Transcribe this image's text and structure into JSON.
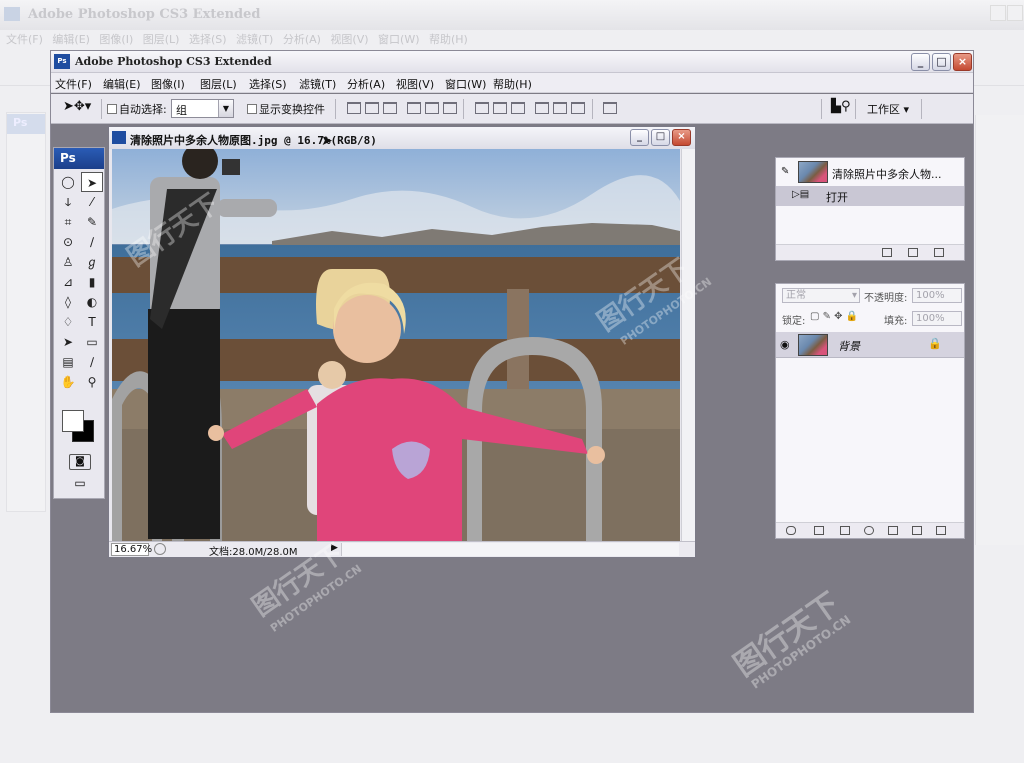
{
  "ghost": {
    "title": "Adobe Photoshop CS3 Extended",
    "menu": "文件(F)  编辑(E)  图像(I)  图层(L)  选择(S)  滤镜(T)  分析(A)  视图(V)  窗口(W)  帮助(H)",
    "ps_label": "Ps"
  },
  "app": {
    "title": "Adobe Photoshop CS3 Extended",
    "logo": "Ps",
    "minimize": "_",
    "maximize": "□",
    "close": "×"
  },
  "menubar": [
    "文件(F)",
    "编辑(E)",
    "图像(I)",
    "图层(L)",
    "选择(S)",
    "滤镜(T)",
    "分析(A)",
    "视图(V)",
    "窗口(W)",
    "帮助(H)"
  ],
  "options": {
    "auto_select_label": "自动选择:",
    "auto_select_value": "组",
    "show_transform_label": "显示变换控件",
    "workspace_label": "工作区 ▾"
  },
  "toolbox": {
    "header": "Ps",
    "tools": [
      {
        "name": "marquee-icon",
        "glyph": "◯"
      },
      {
        "name": "move-icon",
        "glyph": "➤"
      },
      {
        "name": "lasso-icon",
        "glyph": "ↆ"
      },
      {
        "name": "magic-wand-icon",
        "glyph": "⁄"
      },
      {
        "name": "crop-icon",
        "glyph": "⌗"
      },
      {
        "name": "slice-icon",
        "glyph": "✎"
      },
      {
        "name": "healing-icon",
        "glyph": "⊙"
      },
      {
        "name": "brush-icon",
        "glyph": "∕"
      },
      {
        "name": "stamp-icon",
        "glyph": "♙"
      },
      {
        "name": "history-brush-icon",
        "glyph": "ℊ"
      },
      {
        "name": "eraser-icon",
        "glyph": "⊿"
      },
      {
        "name": "gradient-icon",
        "glyph": "▮"
      },
      {
        "name": "blur-icon",
        "glyph": "◊"
      },
      {
        "name": "dodge-icon",
        "glyph": "◐"
      },
      {
        "name": "pen-icon",
        "glyph": "♢"
      },
      {
        "name": "type-icon",
        "glyph": "T"
      },
      {
        "name": "path-select-icon",
        "glyph": "➤"
      },
      {
        "name": "shape-icon",
        "glyph": "▭"
      },
      {
        "name": "notes-icon",
        "glyph": "▤"
      },
      {
        "name": "eyedropper-icon",
        "glyph": "∕"
      },
      {
        "name": "hand-icon",
        "glyph": "✋"
      },
      {
        "name": "zoom-icon",
        "glyph": "⚲"
      }
    ]
  },
  "document": {
    "title": "清除照片中多余人物原图.jpg @ 16.7%(RGB/8)",
    "zoom": "16.67%",
    "doc_size": "文档:28.0M/28.0M",
    "nav_arrow": "▶"
  },
  "history": {
    "snapshot_label": "清除照片中多余人物...",
    "step_label": "打开"
  },
  "layers": {
    "blend_mode": "正常",
    "opacity_label": "不透明度:",
    "opacity_value": "100%",
    "lock_label": "锁定:",
    "fill_label": "填充:",
    "fill_value": "100%",
    "layer_name": "背景"
  },
  "watermarks": {
    "cn": "图行天下",
    "en": "PHOTOPHOTO.CN"
  }
}
